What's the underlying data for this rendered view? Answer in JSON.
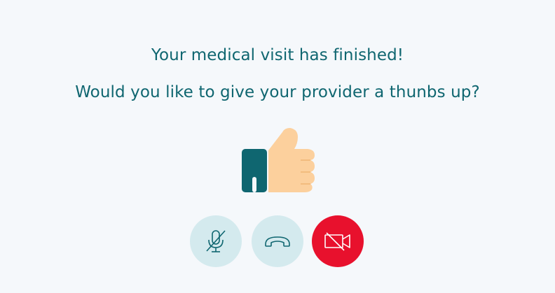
{
  "message": {
    "line1": "Your medical visit has finished!",
    "line2": "Would you like to give your provider a thunbs up?"
  },
  "thumb": {
    "icon": "thumbs-up-icon",
    "cuff_color": "#0f6670",
    "hand_color": "#fcd09d"
  },
  "controls": [
    {
      "name": "mute-microphone",
      "icon": "microphone-off-icon",
      "background": "#d4eaee"
    },
    {
      "name": "end-call",
      "icon": "phone-hangup-icon",
      "background": "#d4eaee"
    },
    {
      "name": "video-off",
      "icon": "video-off-icon",
      "background": "#e8112d"
    }
  ],
  "colors": {
    "background": "#f5f8fb",
    "text": "#0f6670",
    "accent_red": "#e8112d",
    "button_light": "#d4eaee"
  }
}
